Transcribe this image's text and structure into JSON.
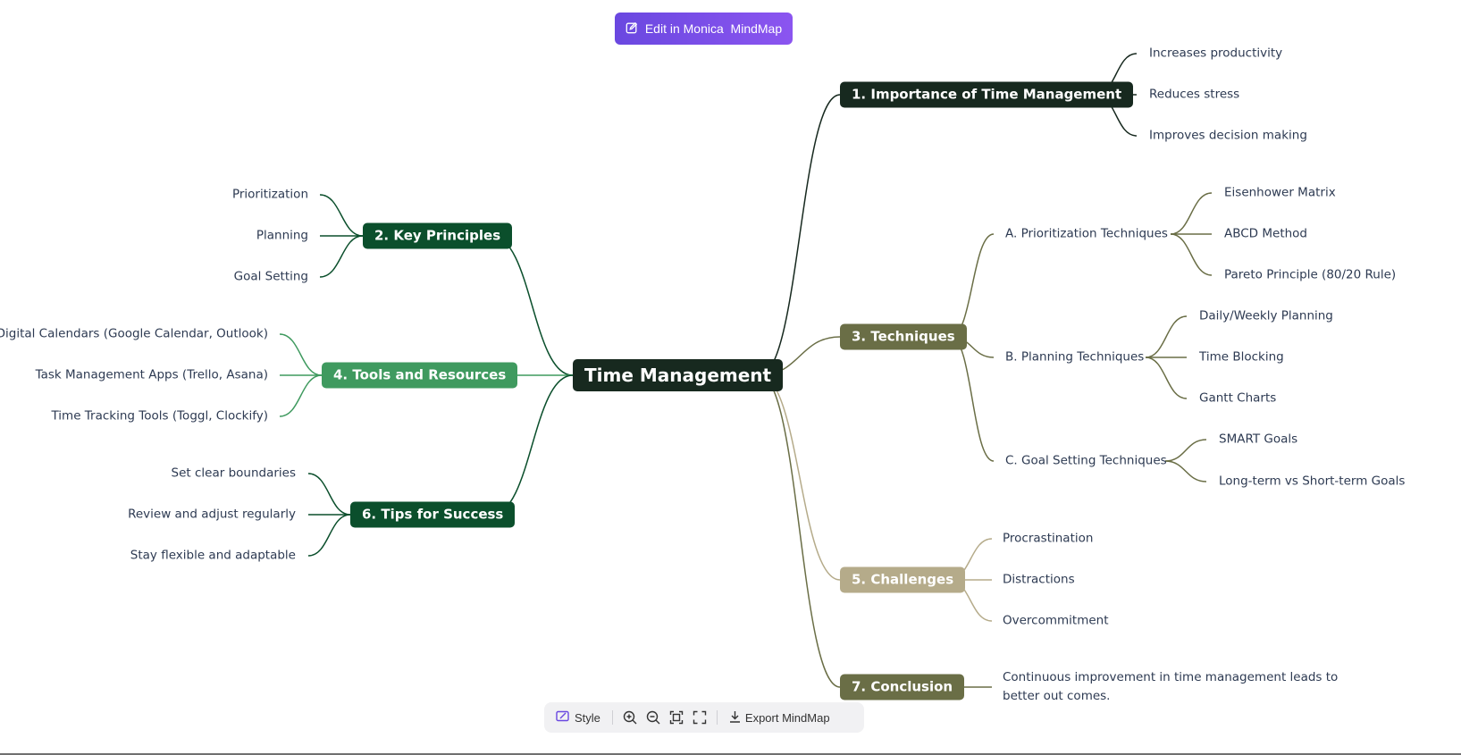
{
  "edit_button": {
    "label": "Edit in Monica  MindMap"
  },
  "toolbar": {
    "style_label": "Style",
    "export_label": "Export MindMap"
  },
  "colors": {
    "root": "#17291f",
    "importance": "#17291f",
    "key_principles": "#0b4f2c",
    "tools": "#3f9a5f",
    "tips": "#0b4f2c",
    "techniques": "#6a6e46",
    "challenges": "#b5ab8a",
    "conclusion": "#6a6e46",
    "leaf_text": "#2d3a52"
  },
  "mindmap": {
    "root": "Time Management",
    "importance": {
      "title": "1. Importance of Time Management",
      "items": [
        "Increases productivity",
        "Reduces stress",
        "Improves decision making"
      ]
    },
    "key_principles": {
      "title": "2. Key Principles",
      "items": [
        "Prioritization",
        "Planning",
        "Goal Setting"
      ]
    },
    "techniques": {
      "title": "3. Techniques",
      "groups": [
        {
          "title": "A. Prioritization Techniques",
          "items": [
            "Eisenhower Matrix",
            "ABCD Method",
            "Pareto Principle (80/20 Rule)"
          ]
        },
        {
          "title": "B. Planning Techniques",
          "items": [
            "Daily/Weekly Planning",
            "Time Blocking",
            "Gantt Charts"
          ]
        },
        {
          "title": "C. Goal Setting Techniques",
          "items": [
            "SMART Goals",
            "Long-term vs Short-term Goals"
          ]
        }
      ]
    },
    "tools": {
      "title": "4. Tools and Resources",
      "items": [
        "Digital Calendars (Google Calendar, Outlook)",
        "Task Management Apps (Trello, Asana)",
        "Time Tracking Tools (Toggl, Clockify)"
      ]
    },
    "challenges": {
      "title": "5. Challenges",
      "items": [
        "Procrastination",
        "Distractions",
        "Overcommitment"
      ]
    },
    "tips": {
      "title": "6. Tips for Success",
      "items": [
        "Set clear boundaries",
        "Review and adjust regularly",
        "Stay flexible and adaptable"
      ]
    },
    "conclusion": {
      "title": "7. Conclusion",
      "items": [
        "Continuous improvement in time management leads to better out comes."
      ]
    }
  }
}
